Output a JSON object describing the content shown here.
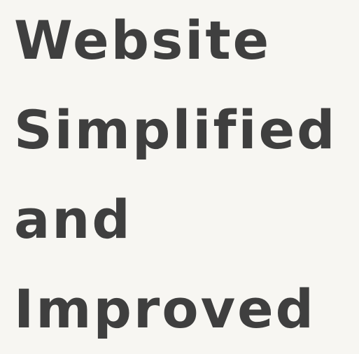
{
  "hero": {
    "lines": [
      "Website",
      "Simplified",
      "and",
      "Improved"
    ]
  },
  "colors": {
    "background": "#f7f6f2",
    "text": "#3f3f3f"
  }
}
